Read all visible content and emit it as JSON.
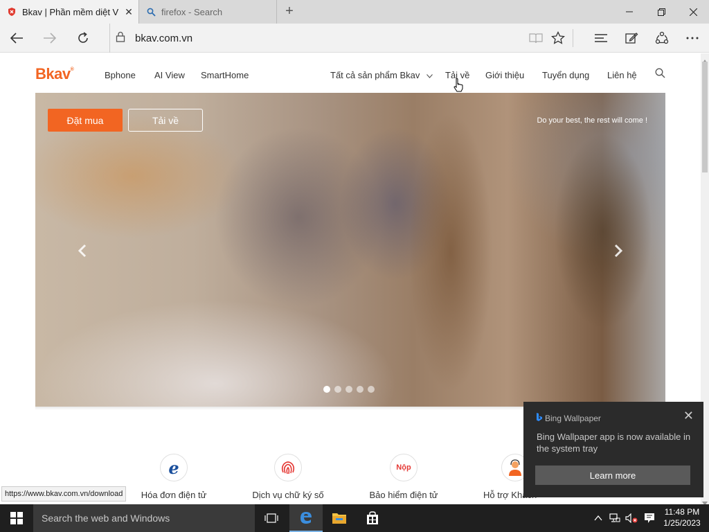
{
  "browser": {
    "tabs": [
      {
        "label": "Bkav | Phần mềm diệt V",
        "active": true,
        "icon": "bkav-shield-icon"
      },
      {
        "label": "firefox - Search",
        "active": false,
        "icon": "search-icon"
      }
    ],
    "address": "bkav.com.vn",
    "status_url": "https://www.bkav.com.vn/download"
  },
  "site": {
    "logo": "Bkav",
    "logo_mark": "®",
    "nav_left": [
      "Bphone",
      "AI View",
      "SmartHome"
    ],
    "nav_right": [
      "Tất cả sản phẩm Bkav",
      "Tải về",
      "Giới thiệu",
      "Tuyển dụng",
      "Liên hệ"
    ],
    "hero": {
      "buy_label": "Đặt mua",
      "download_label": "Tải về",
      "slogan": "Do your best, the rest will come !",
      "slides": 5,
      "active_slide": 1
    },
    "features": [
      "Hóa đơn điện tử",
      "Dịch vụ chữ ký số",
      "Bảo hiểm điện tử",
      "Hỗ trợ Khách"
    ],
    "feature_icon_text": {
      "invoice": "e",
      "insurance": "Nộp"
    }
  },
  "notification": {
    "app": "Bing Wallpaper",
    "message": "Bing Wallpaper app is now available in the system tray",
    "button": "Learn more"
  },
  "taskbar": {
    "search_placeholder": "Search the web and Windows",
    "time": "11:48 PM",
    "date": "1/25/2023"
  },
  "colors": {
    "brand": "#f26522",
    "tabbar": "#d9d9d9",
    "taskbar": "#1f1f1f"
  }
}
